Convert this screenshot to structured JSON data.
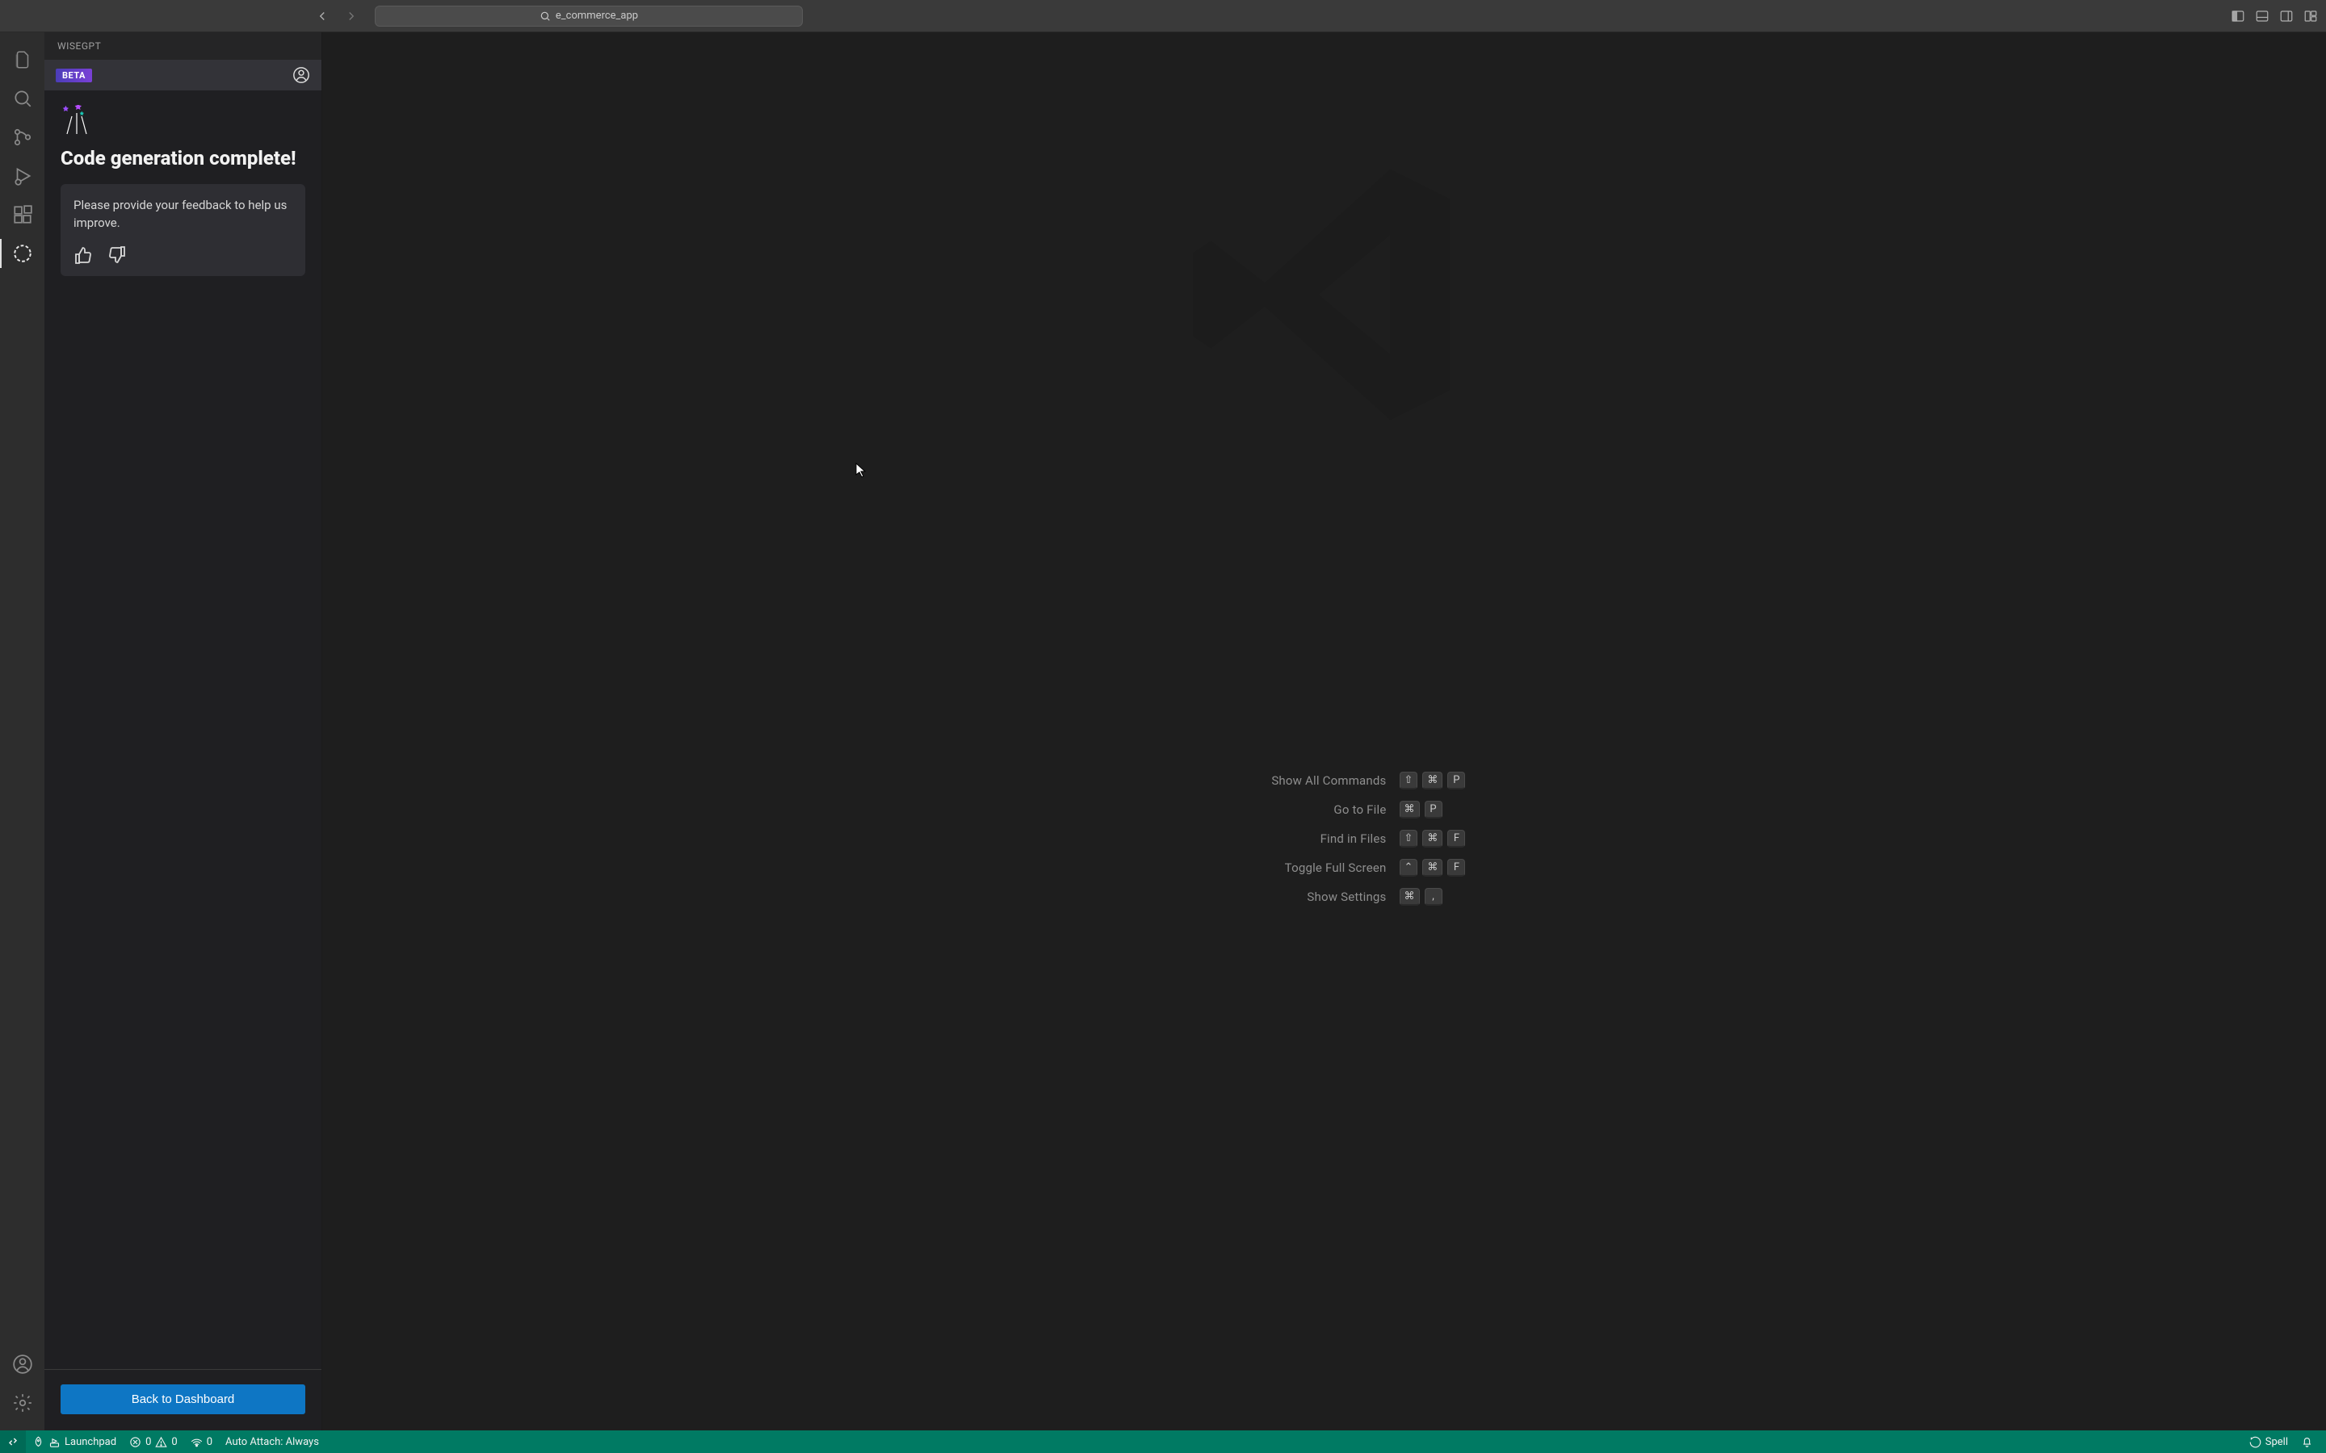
{
  "titlebar": {
    "search_text": "e_commerce_app"
  },
  "sidebar": {
    "title": "WISEGPT",
    "beta_label": "BETA",
    "heading": "Code generation complete!",
    "feedback_prompt": "Please provide your feedback to help us improve.",
    "dashboard_button": "Back to Dashboard"
  },
  "editor_shortcuts": [
    {
      "label": "Show All Commands",
      "keys": [
        "⇧",
        "⌘",
        "P"
      ]
    },
    {
      "label": "Go to File",
      "keys": [
        "⌘",
        "P"
      ]
    },
    {
      "label": "Find in Files",
      "keys": [
        "⇧",
        "⌘",
        "F"
      ]
    },
    {
      "label": "Toggle Full Screen",
      "keys": [
        "⌃",
        "⌘",
        "F"
      ]
    },
    {
      "label": "Show Settings",
      "keys": [
        "⌘",
        ","
      ]
    }
  ],
  "statusbar": {
    "launchpad": "Launchpad",
    "errors": "0",
    "warnings": "0",
    "ports": "0",
    "auto_attach": "Auto Attach: Always",
    "spell": "Spell"
  }
}
